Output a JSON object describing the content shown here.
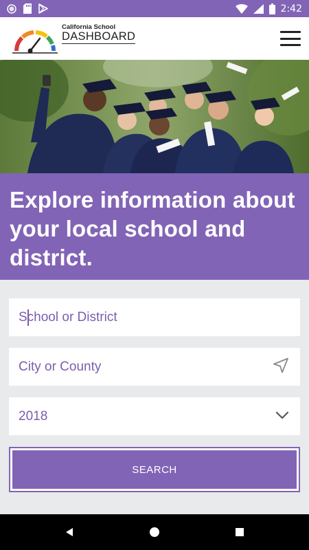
{
  "status_bar": {
    "time": "2:42",
    "icons": [
      "record-icon",
      "sd-card-icon",
      "play-store-icon",
      "wifi-icon",
      "signal-icon",
      "battery-icon"
    ]
  },
  "header": {
    "logo_line1": "California School",
    "logo_line2": "DASHBOARD",
    "menu_icon": "hamburger-menu-icon"
  },
  "hero": {
    "image": "graduates-selfie-photo"
  },
  "banner": {
    "headline": "Explore information about your local school and district."
  },
  "form": {
    "school_placeholder": "School or District",
    "city_placeholder": "City or County",
    "year_value": "2018",
    "search_label": "SEARCH"
  },
  "nav": {
    "icons": [
      "back-icon",
      "home-icon",
      "recents-icon"
    ]
  },
  "colors": {
    "primary": "#8264b6",
    "text_accent": "#7c5cb0",
    "background": "#e8eaec"
  }
}
